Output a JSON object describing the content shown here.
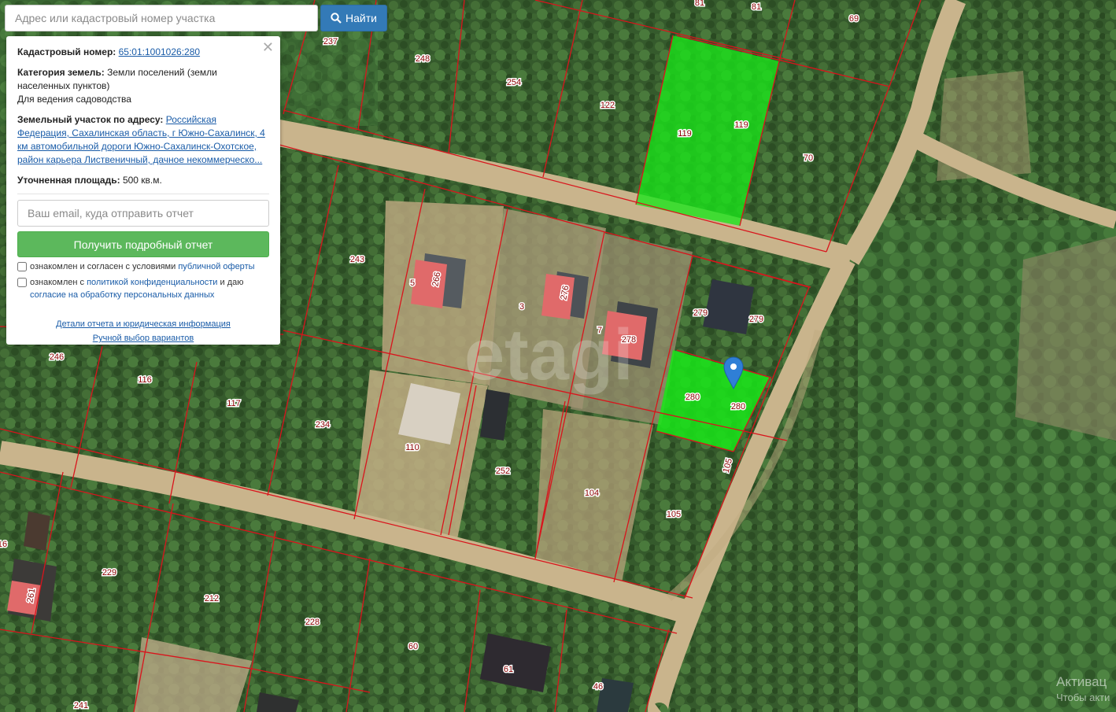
{
  "search": {
    "placeholder": "Адрес или кадастровый номер участка",
    "button_label": "Найти"
  },
  "panel": {
    "cadastral_label": "Кадастровый номер:",
    "cadastral_value": "65:01:1001026:280",
    "category_label": "Категория земель:",
    "category_value": "Земли поселений (земли населенных пунктов)",
    "usage": "Для ведения садоводства",
    "address_label": "Земельный участок по адресу:",
    "address_value": "Российская Федерация, Сахалинская область, г Южно-Сахалинск, 4 км автомобильной дороги Южно-Сахалинск-Охотское, район карьера Лиственичный, дачное некоммерческо...",
    "area_label": "Уточненная площадь:",
    "area_value": "500 кв.м.",
    "email_placeholder": "Ваш email, куда отправить отчет",
    "report_button": "Получить подробный отчет",
    "consent1_text": "ознакомлен и согласен с условиями",
    "consent1_link": "публичной оферты",
    "consent2_text_a": "ознакомлен с",
    "consent2_link_a": "политикой конфиденциальности",
    "consent2_text_b": "и даю",
    "consent2_link_b": "согласие на обработку персональных данных",
    "details_link": "Детали отчета и юридическая информация",
    "manual_link": "Ручной выбор вариантов"
  },
  "map": {
    "watermark_logo": "etagi",
    "highlighted_parcels": [
      "119",
      "280"
    ],
    "parcel_labels": [
      "237",
      "248",
      "254",
      "122",
      "119",
      "119",
      "81",
      "81",
      "69",
      "70",
      "243",
      "266",
      "5",
      "3",
      "276",
      "7",
      "278",
      "279",
      "279",
      "280",
      "280",
      "105",
      "105",
      "246",
      "116",
      "117",
      "234",
      "110",
      "252",
      "104",
      "229",
      "212",
      "228",
      "60",
      "61",
      "46",
      "241",
      "261",
      "16"
    ],
    "marker_icon": "map-pin-icon",
    "colors": {
      "highlight": "#19e619",
      "boundary": "#d9141c",
      "label_text": "#8b0000",
      "roof_red": "#e06a6a"
    }
  },
  "os_watermark": {
    "line1": "Активац",
    "line2": "Чтобы акти"
  }
}
